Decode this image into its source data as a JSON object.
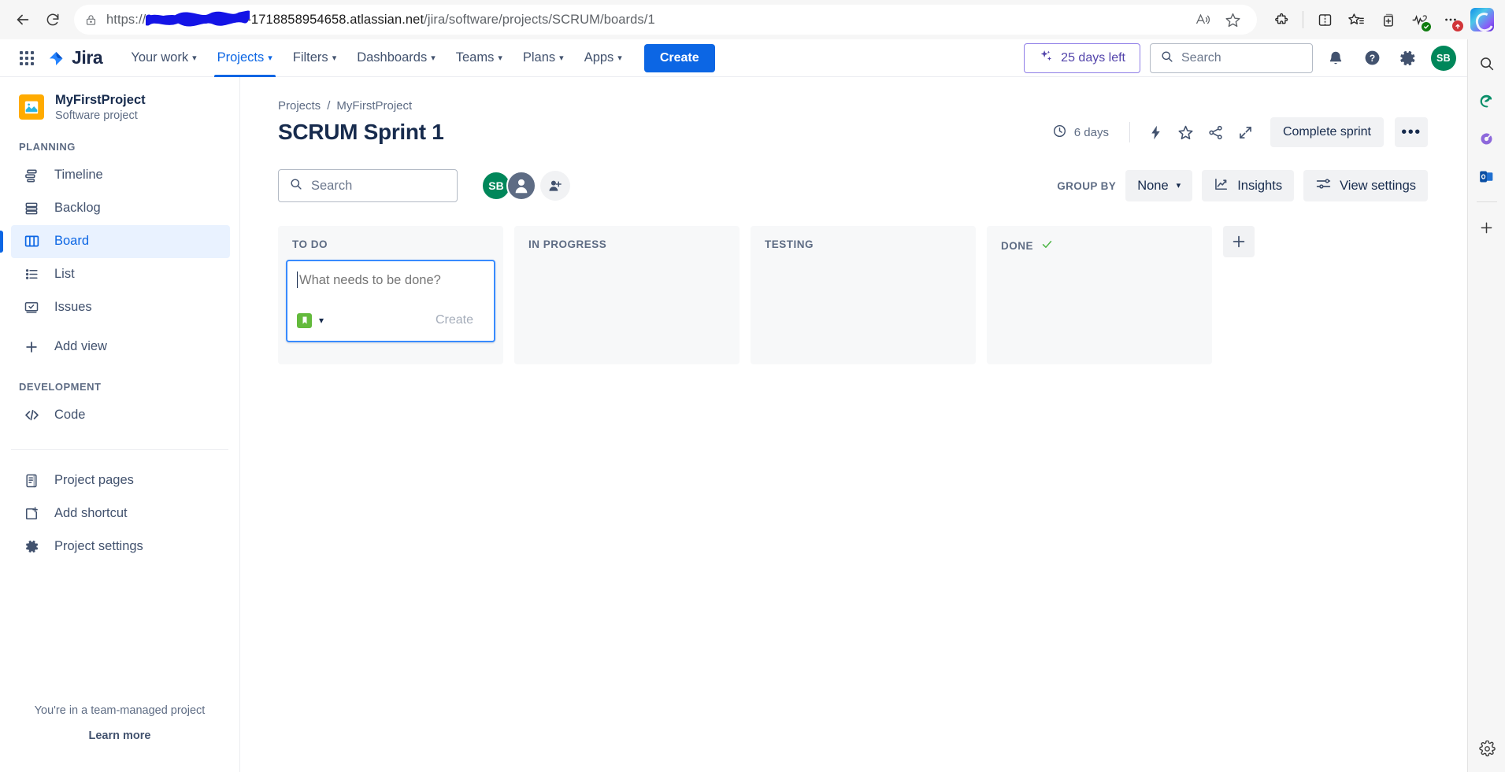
{
  "browser": {
    "url_prefix": "https://",
    "url_redacted": "redacted-site-name",
    "url_suffix": "-1718858954658.atlassian.net",
    "url_path": "/jira/software/projects/SCRUM/boards/1",
    "back_icon": "back-arrow-icon",
    "reload_icon": "reload-icon",
    "lock_icon": "lock-icon",
    "read_aloud_icon": "read-aloud-icon",
    "favorite_icon": "star-icon",
    "extensions_icon": "extensions-puzzle-icon",
    "split_screen_icon": "split-screen-icon",
    "favorites_bar_icon": "favorites-list-icon",
    "collections_icon": "collections-icon",
    "browser_essentials_icon": "browser-essentials-icon",
    "settings_more_icon": "settings-and-more-icon",
    "settings_more_badge": "",
    "copilot_icon": "copilot-icon",
    "sidebar": {
      "search_icon": "search-icon",
      "shopping_icon": "shopping-icon",
      "tools_icon": "tools-icon",
      "outlook_icon": "outlook-icon",
      "add_icon": "add-icon",
      "settings_icon": "settings-icon"
    }
  },
  "topnav": {
    "app_switcher": "app-switcher-icon",
    "logo_text": "Jira",
    "items": [
      {
        "label": "Your work",
        "active": false
      },
      {
        "label": "Projects",
        "active": true
      },
      {
        "label": "Filters",
        "active": false
      },
      {
        "label": "Dashboards",
        "active": false
      },
      {
        "label": "Teams",
        "active": false
      },
      {
        "label": "Plans",
        "active": false
      },
      {
        "label": "Apps",
        "active": false
      }
    ],
    "create_label": "Create",
    "trial_label": "25 days left",
    "trial_icon": "sparkle-icon",
    "search_placeholder": "Search",
    "search_icon": "search-icon",
    "notifications_icon": "notification-bell-icon",
    "help_icon": "help-question-icon",
    "settings_icon": "gear-icon",
    "avatar_initials": "SB",
    "accent_blue": "#0c66e4",
    "trial_purple": "#5243aa",
    "avatar_green": "#00875a"
  },
  "sidebar": {
    "project_name": "MyFirstProject",
    "project_type": "Software project",
    "project_icon": "project-image-icon",
    "project_icon_color": "#ffab00",
    "section_planning": "PLANNING",
    "section_development": "DEVELOPMENT",
    "planning_items": [
      {
        "label": "Timeline",
        "icon": "timeline-icon",
        "selected": false
      },
      {
        "label": "Backlog",
        "icon": "backlog-icon",
        "selected": false
      },
      {
        "label": "Board",
        "icon": "board-columns-icon",
        "selected": true
      },
      {
        "label": "List",
        "icon": "list-icon",
        "selected": false
      },
      {
        "label": "Issues",
        "icon": "issues-icon",
        "selected": false
      },
      {
        "label": "Add view",
        "icon": "plus-icon",
        "selected": false
      }
    ],
    "development_items": [
      {
        "label": "Code",
        "icon": "code-icon",
        "selected": false
      }
    ],
    "extra_items": [
      {
        "label": "Project pages",
        "icon": "project-pages-icon",
        "selected": false
      },
      {
        "label": "Add shortcut",
        "icon": "add-shortcut-icon",
        "selected": false
      },
      {
        "label": "Project settings",
        "icon": "project-settings-gear-icon",
        "selected": false
      }
    ],
    "footer_note": "You're in a team-managed project",
    "footer_link": "Learn more"
  },
  "main": {
    "breadcrumb": [
      "Projects",
      "MyFirstProject"
    ],
    "breadcrumb_separator": "/",
    "page_title": "SCRUM Sprint 1",
    "days_remaining": "6 days",
    "clock_icon": "clock-icon",
    "automation_icon": "lightning-bolt-icon",
    "star_icon": "star-icon",
    "share_icon": "share-icon",
    "expand_icon": "expand-icon",
    "complete_sprint_label": "Complete sprint",
    "more_actions_label": "•••",
    "search_placeholder": "Search",
    "search_icon": "search-icon",
    "assignee_avatars": [
      {
        "initials": "SB",
        "type": "user"
      },
      {
        "initials": "",
        "type": "unassigned"
      }
    ],
    "add_people_icon": "add-person-icon",
    "group_by_label": "GROUP BY",
    "group_by_value": "None",
    "insights_label": "Insights",
    "insights_icon": "insights-chart-icon",
    "view_settings_label": "View settings",
    "view_settings_icon": "sliders-icon",
    "add_column_icon": "plus-icon"
  },
  "board": {
    "columns": [
      {
        "title": "TO DO",
        "done": false,
        "cards": []
      },
      {
        "title": "IN PROGRESS",
        "done": false,
        "cards": []
      },
      {
        "title": "TESTING",
        "done": false,
        "cards": []
      },
      {
        "title": "DONE",
        "done": true,
        "cards": []
      }
    ],
    "done_check_icon": "green-check-icon",
    "add_card": {
      "placeholder": "What needs to be done?",
      "value": "",
      "issue_type_icon": "story-icon",
      "issue_type_color": "#63ba3c",
      "chevron_icon": "chevron-down-icon",
      "create_label": "Create"
    }
  }
}
